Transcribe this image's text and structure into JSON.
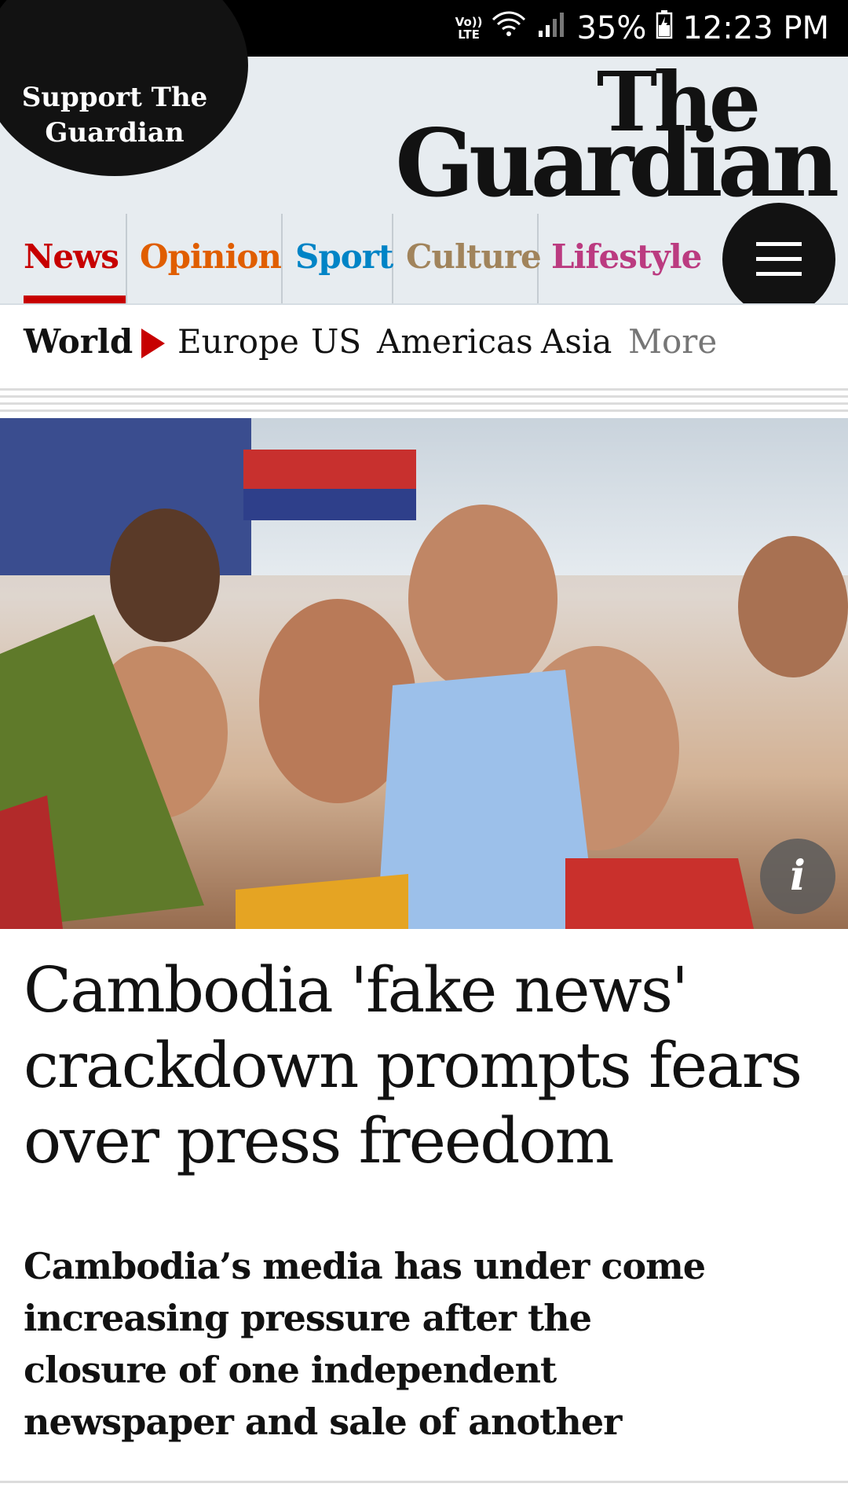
{
  "status_bar": {
    "battery": "35%",
    "time": "12:23 PM",
    "more": "...",
    "network_label_top": "Vo))",
    "network_label_bottom": "LTE",
    "icons": [
      "gallery-icon",
      "mail-icon",
      "phone-icon",
      "wifi-icon",
      "signal-icon",
      "battery-icon"
    ]
  },
  "header": {
    "support_line1": "Support The",
    "support_line2": "Guardian",
    "logo_line1": "The",
    "logo_line2": "Guardian",
    "pillars": [
      {
        "label": "News",
        "color": "#c70000",
        "active": true
      },
      {
        "label": "Opinion",
        "color": "#e05e00"
      },
      {
        "label": "Sport",
        "color": "#0084c6"
      },
      {
        "label": "Culture",
        "color": "#a1845c"
      },
      {
        "label": "Lifestyle",
        "color": "#bb3b80"
      }
    ],
    "menu_icon": "hamburger-icon"
  },
  "subnav": {
    "current": "World",
    "items": [
      "Europe",
      "US",
      "Americas",
      "Asia"
    ],
    "more": "More"
  },
  "article": {
    "image_info_label": "i",
    "headline": "Cambodia 'fake news' crackdown prompts fears over press freedom",
    "standfirst": "Cambodia’s media has under come increasing pressure after the closure of one independent newspaper and sale of another"
  }
}
